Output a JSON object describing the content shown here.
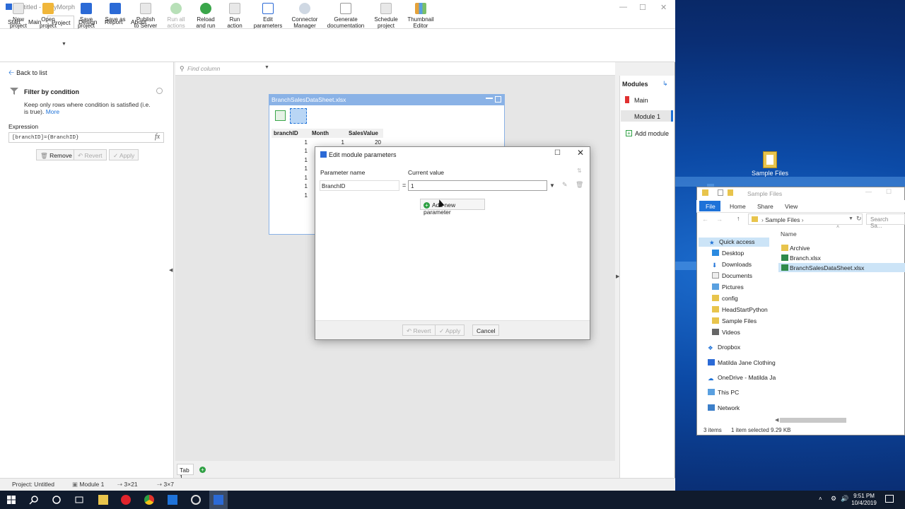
{
  "app": {
    "title": "Untitled - EasyMorph",
    "menu": [
      "Start",
      "Main",
      "Project",
      "Design",
      "Report",
      "About"
    ],
    "ribbon": [
      {
        "label": "New\nproject",
        "line1": "New",
        "line2": "project"
      },
      {
        "line1": "Open",
        "line2": "project"
      },
      {
        "line1": "Save",
        "line2": "project"
      },
      {
        "line1": "Save as",
        "line2": ""
      },
      {
        "line1": "Publish",
        "line2": "to Server"
      },
      {
        "line1": "Run all",
        "line2": "actions"
      },
      {
        "line1": "Reload",
        "line2": "and run"
      },
      {
        "line1": "Run",
        "line2": "action"
      },
      {
        "line1": "Edit",
        "line2": "parameters"
      },
      {
        "line1": "Connector",
        "line2": "Manager"
      },
      {
        "line1": "Generate",
        "line2": "documentation"
      },
      {
        "line1": "Schedule",
        "line2": "project"
      },
      {
        "line1": "Thumbnail",
        "line2": "Editor"
      }
    ]
  },
  "left_panel": {
    "back": "Back to list",
    "filter_title": "Filter by condition",
    "filter_desc": "Keep only rows where condition is satisfied (i.e. is true).",
    "more": "More",
    "expr_label": "Expression",
    "expr_value": "[branchID]={BranchID}",
    "remove": "Remove",
    "revert": "Revert",
    "apply": "Apply"
  },
  "workspace": {
    "find_placeholder": "Find column",
    "data_title": "BranchSalesDataSheet.xlsx",
    "columns": [
      "branchID",
      "Month",
      "SalesValue"
    ],
    "rows": [
      [
        "1",
        "1",
        "20"
      ],
      [
        "1",
        "",
        ""
      ],
      [
        "1",
        "",
        ""
      ],
      [
        "1",
        "",
        ""
      ],
      [
        "1",
        "",
        ""
      ],
      [
        "1",
        "",
        ""
      ],
      [
        "1",
        "",
        ""
      ]
    ]
  },
  "dialog": {
    "title": "Edit module parameters",
    "col_name": "Parameter name",
    "col_value": "Current value",
    "param_name": "BranchID",
    "param_value": "1",
    "add_param": "Add new parameter",
    "revert": "Revert",
    "apply": "Apply",
    "cancel": "Cancel"
  },
  "modules": {
    "header": "Modules",
    "main": "Main",
    "module1": "Module 1",
    "add": "Add module"
  },
  "tabs": {
    "tab1": "Tab 1"
  },
  "status": {
    "project": "Project: Untitled",
    "module": "Module 1",
    "dims1": "3×21",
    "dims2": "3×7"
  },
  "desktop": {
    "icon_label": "Sample Files"
  },
  "explorer": {
    "title": "Sample Files",
    "tabs": [
      "File",
      "Home",
      "Share",
      "View"
    ],
    "address": "Sample Files",
    "search": "Search Sa...",
    "nav": [
      "Quick access",
      "Desktop",
      "Downloads",
      "Documents",
      "Pictures",
      "config",
      "HeadStartPython",
      "Sample Files",
      "Videos",
      "Dropbox",
      "Matilda Jane Clothing",
      "OneDrive - Matilda Ja",
      "This PC",
      "Network"
    ],
    "name_col": "Name",
    "files": [
      "Archive",
      "Branch.xlsx",
      "BranchSalesDataSheet.xlsx"
    ],
    "footer_count": "3 items",
    "footer_sel": "1 item selected  9.29 KB"
  },
  "taskbar": {
    "time": "9:51 PM",
    "date": "10/4/2019"
  }
}
